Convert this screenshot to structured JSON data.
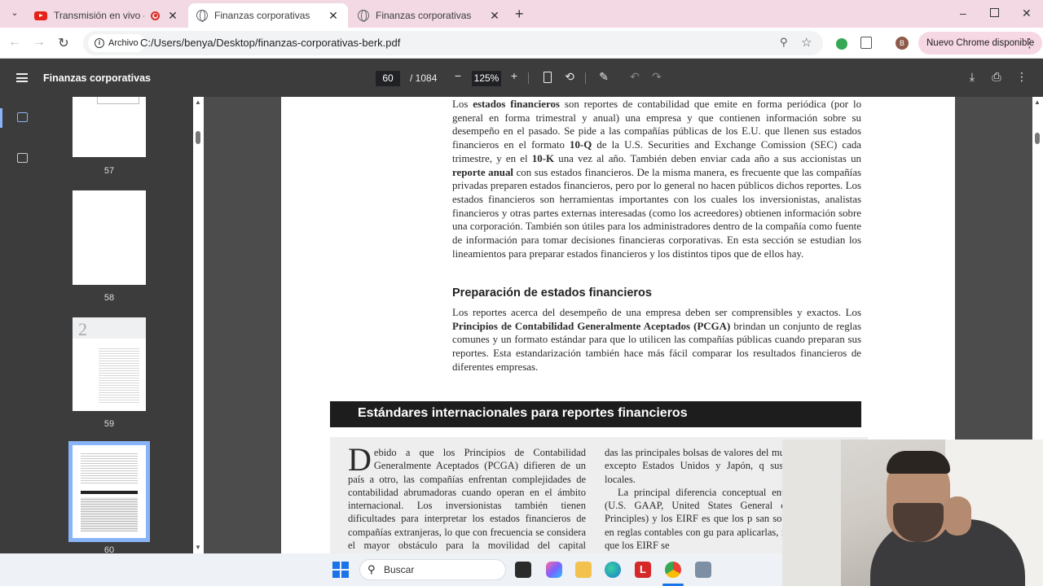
{
  "browser": {
    "tabs": [
      {
        "label": "Transmisión en vivo - YouTu",
        "icon": "youtube-icon",
        "active": false
      },
      {
        "label": "Finanzas corporativas",
        "icon": "globe-icon",
        "active": true
      },
      {
        "label": "Finanzas corporativas",
        "icon": "globe-icon",
        "active": false
      }
    ],
    "omnibox": {
      "chip_label": "Archivo",
      "url": "C:/Users/benya/Desktop/finanzas-corporativas-berk.pdf"
    },
    "profile_initial": "B",
    "update_label": "Nuevo Chrome disponible",
    "colors": {
      "tabstrip": "#f2d9e4",
      "update_chip": "#f6d7e4",
      "pdf_toolbar": "#3c3c3c"
    }
  },
  "pdf": {
    "title": "Finanzas corporativas",
    "current_page": "60",
    "total_pages": "/ 1084",
    "zoom": "125%",
    "thumbnails": [
      {
        "page": "57"
      },
      {
        "page": "58"
      },
      {
        "page": "59",
        "chapter_mark": "2"
      },
      {
        "page": "60",
        "selected": true
      }
    ]
  },
  "doc": {
    "paragraph1": [
      {
        "t": "Los "
      },
      {
        "t": "estados financieros",
        "b": true
      },
      {
        "t": " son reportes de contabilidad que emite en forma periódica (por lo general en forma trimestral y anual) una empresa y que contienen información sobre su desempeño en el pasado. Se pide a las compañías públicas de los E.U. que llenen sus estados financieros en el formato "
      },
      {
        "t": "10-Q",
        "b": true
      },
      {
        "t": " de la U.S. Securities and Exchange Comission (SEC) cada trimestre, y en el "
      },
      {
        "t": "10-K",
        "b": true
      },
      {
        "t": " una vez al año. También deben enviar cada año a sus accionistas un "
      },
      {
        "t": "reporte anual",
        "b": true
      },
      {
        "t": " con sus estados financieros. De la misma manera, es frecuente que las compañías privadas preparen estados financieros, pero por lo general no hacen públicos dichos reportes. Los estados financieros son herramientas importantes con los cuales los inversionistas, analistas financieros y otras partes externas interesadas (como los acreedores) obtienen información sobre una corporación. También son útiles para los administradores dentro de la compañía como fuente de información para tomar decisiones financieras corporativas. En esta sección se estudian los lineamientos para preparar estados financieros y los distintos tipos que de ellos hay."
      }
    ],
    "heading": "Preparación de estados financieros",
    "paragraph2": [
      {
        "t": "Los reportes acerca del desempeño de una empresa deben ser comprensibles y exactos. Los "
      },
      {
        "t": "Principios de Contabilidad Generalmente Aceptados (PCGA)",
        "b": true
      },
      {
        "t": " brindan un conjunto de reglas comunes y un formato estándar para que lo utilicen las compañías públicas cuando preparan sus reportes. Esta estandarización también hace más fácil comparar los resultados financieros de diferentes empresas."
      }
    ],
    "box_title": "Estándares internacionales para reportes financieros",
    "box_dropcap": "D",
    "box_col1": "ebido a que los Principios de Contabilidad Generalmente Aceptados (PCGA) difieren de un país a otro, las compañías enfrentan complejidades de contabilidad abrumadoras cuando operan en el ámbito internacional. Los inversionistas también tienen dificultades para interpretar los estados financieros de compañías extranjeras, lo que con frecuencia se considera el mayor obstáculo para la movilidad del capital internacional. Sin",
    "box_col2_p1": "das las principales bolsas de valores del mun EIRF, excepto Estados Unidos y Japón, q sus PCGA locales.",
    "box_col2_p2": "La principal diferencia conceptual entre E.U. (U.S. GAAP, United States General counting Principles) y los EIRF es que los p san sobre todo en reglas contables con gu para aplicarlas, mientras que los EIRF se"
  },
  "taskbar": {
    "search_placeholder": "Buscar"
  }
}
